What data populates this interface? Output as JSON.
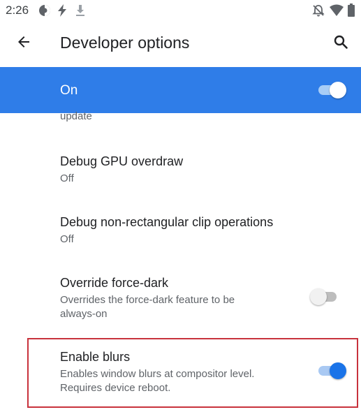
{
  "status_bar": {
    "time": "2:26",
    "icons": [
      "data-saver-icon",
      "flash-icon",
      "download-icon",
      "notifications-off-icon",
      "wifi-icon",
      "battery-icon"
    ]
  },
  "app_bar": {
    "title": "Developer options",
    "back_icon": "arrow-back-icon",
    "search_icon": "search-icon"
  },
  "master_switch": {
    "label": "On",
    "checked": true
  },
  "preferences": [
    {
      "summary": "update"
    },
    {
      "title": "Debug GPU overdraw",
      "summary": "Off"
    },
    {
      "title": "Debug non-rectangular clip operations",
      "summary": "Off"
    },
    {
      "title": "Override force-dark",
      "summary_lines": [
        "Overrides the force-dark feature to be",
        "always-on"
      ],
      "checked": false
    },
    {
      "title": "Enable blurs",
      "summary_lines": [
        "Enables window blurs at compositor level.",
        "Requires device reboot."
      ],
      "checked": true,
      "highlighted": true
    }
  ],
  "colors": {
    "accent": "#2f7de8",
    "switch_on": "#1a73e8",
    "highlight": "#c8323c"
  }
}
